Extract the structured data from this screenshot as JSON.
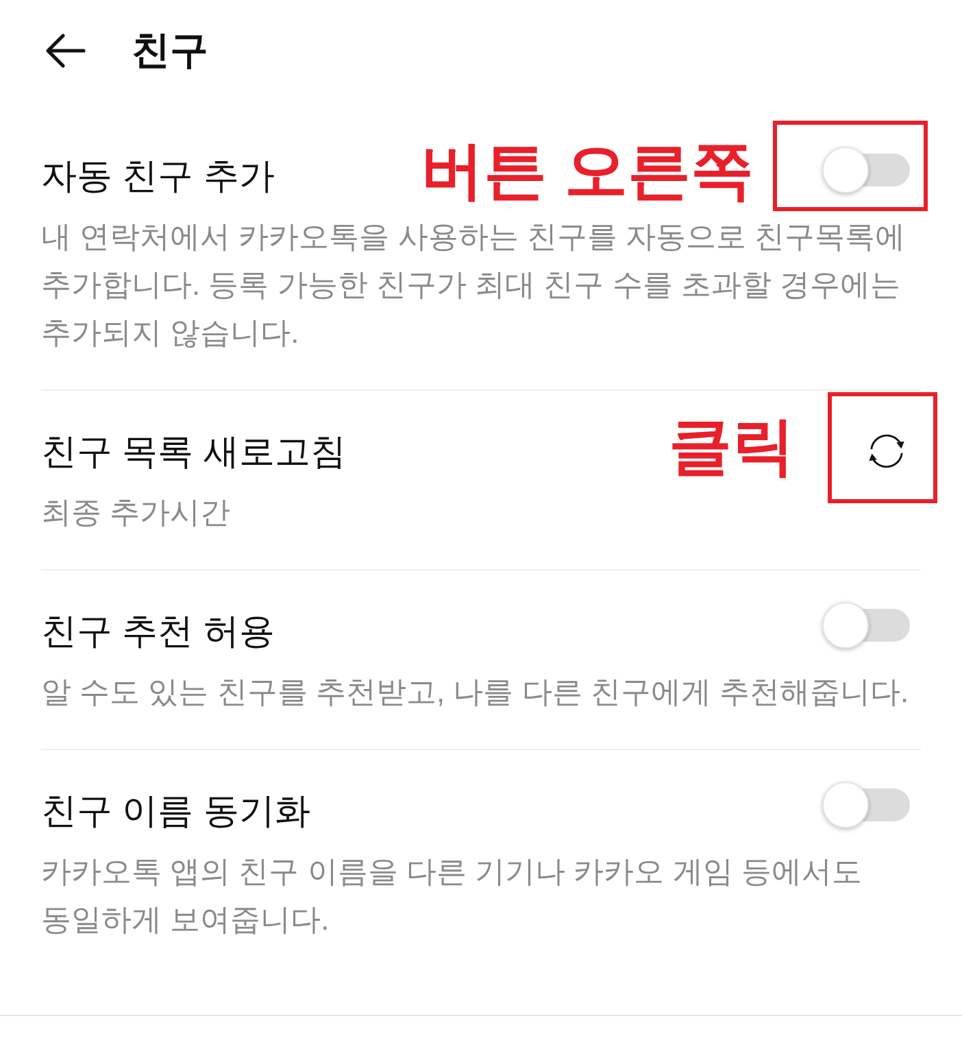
{
  "header": {
    "title": "친구"
  },
  "settings": [
    {
      "kind": "toggle",
      "title": "자동 친구 추가",
      "description": "내 연락처에서 카카오톡을 사용하는 친구를 자동으로 친구목록에 추가합니다. 등록 가능한 친구가 최대 친구 수를 초과할 경우에는 추가되지 않습니다.",
      "on": false,
      "callout": "버튼 오른쪽",
      "highlighted": true
    },
    {
      "kind": "action",
      "title": "친구 목록 새로고침",
      "description": "최종 추가시간",
      "callout": "클릭",
      "highlighted": true
    },
    {
      "kind": "toggle",
      "title": "친구 추천 허용",
      "description": "알 수도 있는 친구를 추천받고, 나를 다른 친구에게 추천해줍니다.",
      "on": false,
      "highlighted": false
    },
    {
      "kind": "toggle",
      "title": "친구 이름 동기화",
      "description": "카카오톡 앱의 친구 이름을 다른 기기나 카카오 게임 등에서도 동일하게 보여줍니다.",
      "on": false,
      "highlighted": false
    }
  ]
}
